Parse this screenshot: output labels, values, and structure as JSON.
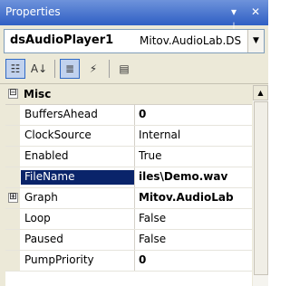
{
  "window": {
    "title": "Properties",
    "pin_glyph": "▾ ⊥",
    "close_glyph": "✕"
  },
  "object_selector": {
    "name": "dsAudioPlayer1",
    "type": "Mitov.AudioLab.DS",
    "dropdown_glyph": "▼"
  },
  "toolbar": {
    "categorized_icon": "☷",
    "alphabetical_icon": "A↓",
    "properties_icon": "≣",
    "events_icon": "⚡",
    "property_pages_icon": "▤"
  },
  "grid": {
    "category": {
      "toggle": "⊟",
      "label": "Misc"
    },
    "rows": [
      {
        "name": "BuffersAhead",
        "value": "0"
      },
      {
        "name": "ClockSource",
        "value": "Internal"
      },
      {
        "name": "Enabled",
        "value": "True"
      },
      {
        "name": "FileName",
        "value": "iles\\Demo.wav"
      },
      {
        "name": "Graph",
        "value": "Mitov.AudioLab",
        "toggle": "⊞"
      },
      {
        "name": "Loop",
        "value": "False"
      },
      {
        "name": "Paused",
        "value": "False"
      },
      {
        "name": "PumpPriority",
        "value": "0"
      }
    ]
  },
  "scrollbar": {
    "up_glyph": "▲"
  },
  "colors": {
    "title_bar": "#2f5fc4",
    "selection": "#0a246a",
    "panel": "#ece9d8"
  }
}
